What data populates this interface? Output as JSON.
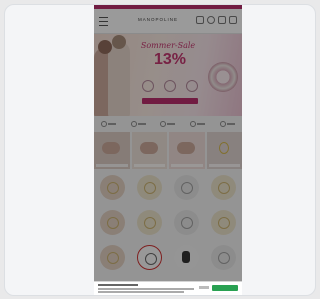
{
  "header": {
    "logo": "MANOPOLINE"
  },
  "hero": {
    "title": "Sommer-Sale",
    "discount": "13%"
  },
  "grid_rows": 3
}
